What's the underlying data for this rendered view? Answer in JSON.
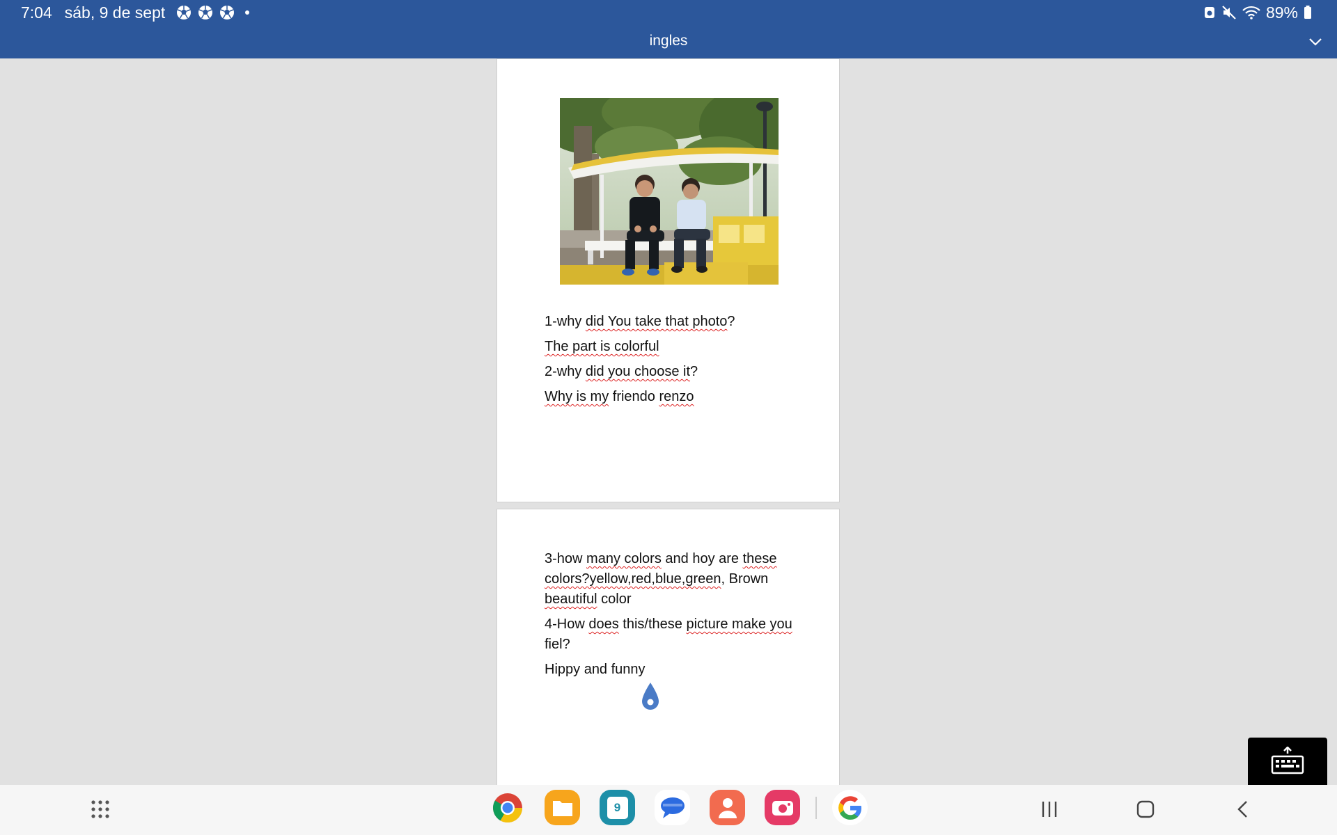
{
  "status_bar": {
    "time": "7:04",
    "date": "sáb, 9 de sept",
    "notification_icons": [
      "soccer-ball-icon",
      "soccer-ball-icon",
      "soccer-ball-icon"
    ],
    "battery": "89%"
  },
  "title_bar": {
    "title": "ingles"
  },
  "page1": {
    "photo": {
      "description_icon": "photo-two-boys-on-bench"
    },
    "lines": [
      {
        "parts": [
          {
            "t": "1-why "
          },
          {
            "t": "did You take that photo",
            "sq": true
          },
          {
            "t": "?"
          }
        ]
      },
      {
        "parts": [
          {
            "t": "The part is colorful",
            "sq": true
          }
        ]
      },
      {
        "parts": [
          {
            "t": "2-why "
          },
          {
            "t": "did you choose it",
            "sq": true
          },
          {
            "t": "?"
          }
        ]
      },
      {
        "parts": [
          {
            "t": "Why is my",
            "sq": true
          },
          {
            "t": " friendo "
          },
          {
            "t": "renzo",
            "sq": true
          }
        ]
      }
    ]
  },
  "page2": {
    "lines": [
      {
        "wrap": true,
        "parts": [
          {
            "t": "3-how "
          },
          {
            "t": "many colors",
            "sq": true
          },
          {
            "t": " and hoy are "
          },
          {
            "t": "these colors?yellow,red,blue,green",
            "sq": true
          },
          {
            "t": ", Brown "
          },
          {
            "t": "beautiful",
            "sq": true
          },
          {
            "t": " color"
          }
        ]
      },
      {
        "wrap": true,
        "parts": [
          {
            "t": "4-How "
          },
          {
            "t": "does",
            "sq": true
          },
          {
            "t": " this/these "
          },
          {
            "t": "picture make you",
            "sq": true
          },
          {
            "t": " fiel?"
          }
        ]
      },
      {
        "parts": [
          {
            "t": "Hippy and funny"
          }
        ]
      }
    ]
  },
  "dock": {
    "apps": [
      "chrome-icon",
      "my-files-icon",
      "calendar-icon",
      "messages-icon",
      "contacts-icon",
      "screen-recorder-icon",
      "google-icon"
    ],
    "calendar_day": "9"
  },
  "colors": {
    "title_bar": "#2c579b",
    "spelling_squiggle": "#dd2222",
    "page_background": "#e1e1e1"
  }
}
